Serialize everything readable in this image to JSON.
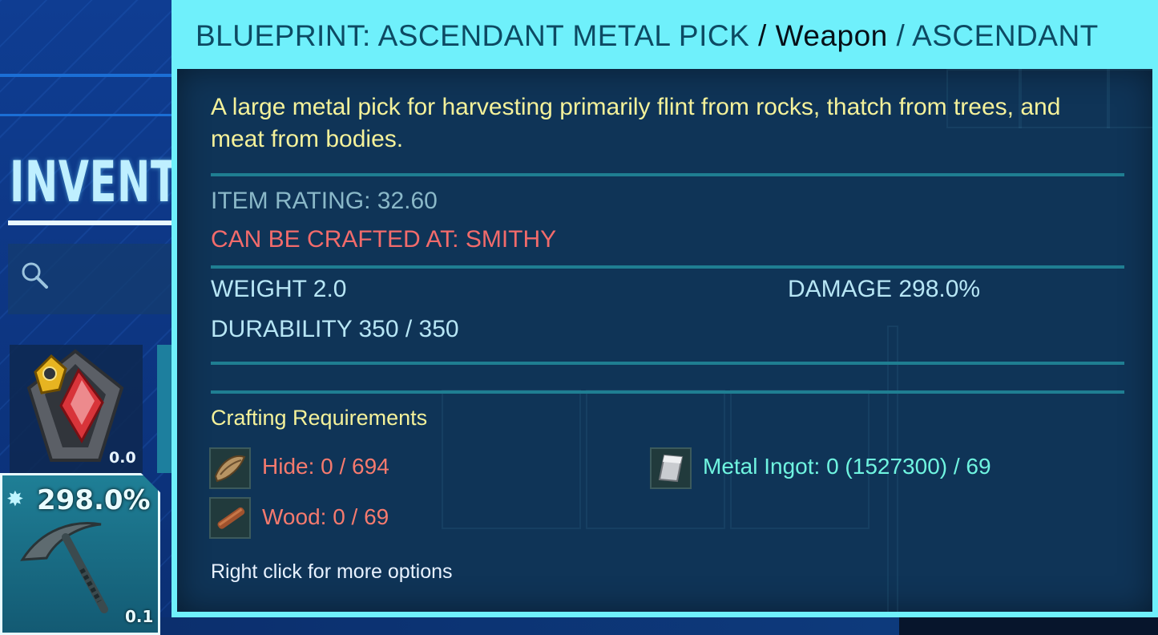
{
  "inventory": {
    "title": "INVENTORY",
    "slots": [
      {
        "value": "0.0"
      },
      {
        "percent": "298.0%",
        "value": "0.1"
      }
    ]
  },
  "tooltip": {
    "title_name": "BLUEPRINT: ASCENDANT METAL PICK",
    "title_sep1": " / ",
    "title_type": "Weapon",
    "title_sep2": " / ",
    "title_quality": "ASCENDANT",
    "description": "A large metal pick for harvesting primarily flint from rocks, thatch from trees, and meat from bodies.",
    "item_rating": "ITEM RATING: 32.60",
    "crafted_at": "CAN BE CRAFTED AT: SMITHY",
    "weight": "WEIGHT 2.0",
    "damage": "DAMAGE 298.0%",
    "durability": "DURABILITY 350 / 350",
    "requirements_title": "Crafting Requirements",
    "requirements": [
      {
        "label": "Hide: 0 / 694",
        "icon": "hide-icon",
        "status": "missing"
      },
      {
        "label": "Wood: 0 / 69",
        "icon": "wood-icon",
        "status": "missing"
      },
      {
        "label": "Metal Ingot: 0 (1527300) / 69",
        "icon": "metal-ingot-icon",
        "status": "available"
      }
    ],
    "hint": "Right click for more options"
  },
  "colors": {
    "tooltip_frame": "#6ff0fb",
    "description": "#f4f19a",
    "missing": "#f57a6e",
    "available": "#6ff4e0",
    "stat": "#b7e6f5"
  }
}
